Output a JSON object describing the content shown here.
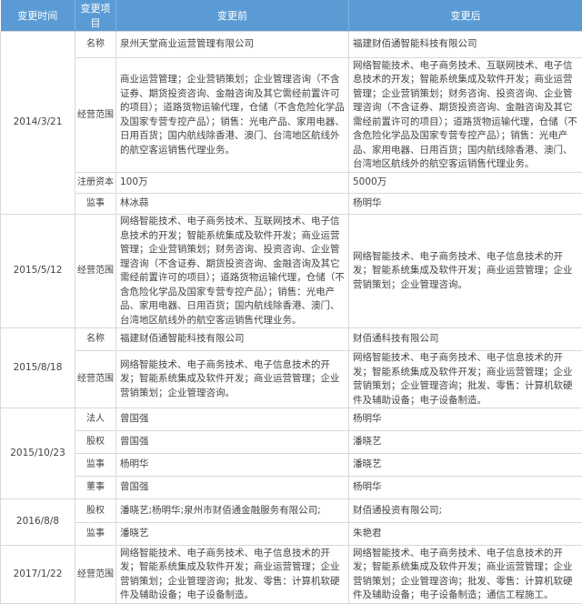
{
  "headers": [
    "变更时间",
    "变更项目",
    "变更前",
    "变更后"
  ],
  "groups": [
    {
      "date": "2014/3/21",
      "items": [
        {
          "label": "名称",
          "before": "泉州天堂商业运营管理有限公司",
          "after": "福建财佰通智能科技有限公司"
        },
        {
          "label": "经营范围",
          "before": "商业运营管理；企业营销策划；企业管理咨询（不含证券、期货投资咨询、金融咨询及其它需经前置许可的项目）；道路货物运输代理，仓储（不含危险化学品及国家专营专控产品）；销售：光电产品、家用电器、日用百货；国内航线除香港、澳门、台湾地区航线外的航空客运销售代理业务。",
          "after": "网络智能技术、电子商务技术、互联网技术、电子信息技术的开发；智能系统集成及软件开发；商业运营管理；企业营销策划；财务咨询、投资咨询、企业管理咨询（不含证券、期货投资咨询、金融咨询及其它需经前置许可的项目）；道路货物运输代理，仓储（不含危险化学品及国家专营专控产品）；销售：光电产品、家用电器、日用百货；国内航线除香港、澳门、台湾地区航线外的航空客运销售代理业务。"
        },
        {
          "label": "注册资本",
          "before": "100万",
          "after": "5000万"
        },
        {
          "label": "监事",
          "before": "林冰蒜",
          "after": "杨明华"
        }
      ]
    },
    {
      "date": "2015/5/12",
      "items": [
        {
          "label": "经营范围",
          "before": "网络智能技术、电子商务技术、互联网技术、电子信息技术的开发；智能系统集成及软件开发；商业运营管理；企业营销策划；财务咨询、投资咨询、企业管理咨询（不含证券、期货投资咨询、金融咨询及其它需经前置许可的项目）；道路货物运输代理，仓储（不含危险化学品及国家专营专控产品）；销售：光电产品、家用电器、日用百货；国内航线除香港、澳门、台湾地区航线外的航空客运销售代理业务。",
          "after": "网络智能技术、电子商务技术、电子信息技术的开发；智能系统集成及软件开发；商业运营管理；企业营销策划；企业管理咨询。"
        }
      ]
    },
    {
      "date": "2015/8/18",
      "items": [
        {
          "label": "名称",
          "before": "福建财佰通智能科技有限公司",
          "after": "财佰通科技有限公司"
        },
        {
          "label": "经营范围",
          "before": "网络智能技术、电子商务技术、电子信息技术的开发；智能系统集成及软件开发；商业运营管理；企业营销策划；企业管理咨询。",
          "after": "网络智能技术、电子商务技术、电子信息技术的开发；智能系统集成及软件开发；商业运营管理；企业营销策划；企业管理咨询；批发、零售：计算机软硬件及辅助设备；电子设备制造。"
        }
      ]
    },
    {
      "date": "2015/10/23",
      "items": [
        {
          "label": "法人",
          "before": "曾国强",
          "after": "杨明华"
        },
        {
          "label": "股权",
          "before": "曾国强",
          "after": "潘晓艺"
        },
        {
          "label": "监事",
          "before": "杨明华",
          "after": "潘晓艺"
        },
        {
          "label": "董事",
          "before": "曾国强",
          "after": "杨明华"
        }
      ]
    },
    {
      "date": "2016/8/8",
      "items": [
        {
          "label": "股权",
          "before": "潘晓艺;杨明华;泉州市财佰通金融服务有限公司;",
          "after": "财佰通投资有限公司;"
        },
        {
          "label": "监事",
          "before": "潘晓艺",
          "after": "朱艳君"
        }
      ]
    },
    {
      "date": "2017/1/22",
      "items": [
        {
          "label": "经营范围",
          "before": "网络智能技术、电子商务技术、电子信息技术的开发；智能系统集成及软件开发；商业运营管理；企业营销策划；企业管理咨询；批发、零售：计算机软硬件及辅助设备；电子设备制造。",
          "after": "网络智能技术、电子商务技术、电子信息技术的开发；智能系统集成及软件开发；商业运营管理；企业营销策划；企业管理咨询；批发、零售：计算机软硬件及辅助设备；电子设备制造；通信工程施工。"
        }
      ]
    }
  ]
}
